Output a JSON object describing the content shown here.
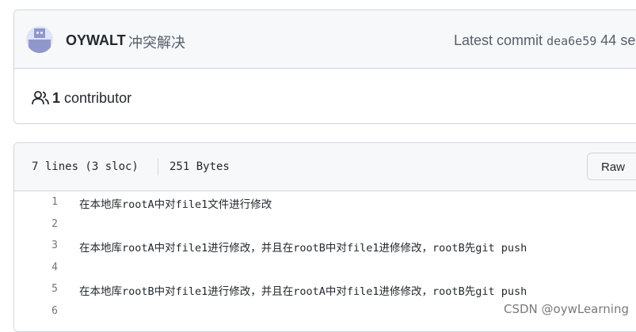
{
  "commit": {
    "author": "OYWALT",
    "message": "冲突解决",
    "latest_label": "Latest commit",
    "sha": "dea6e59",
    "time": "44 se"
  },
  "contributors": {
    "count": "1",
    "label": "contributor"
  },
  "file": {
    "lines_info": "7 lines (3 sloc)",
    "size": "251 Bytes",
    "raw_label": "Raw",
    "lines": [
      {
        "num": "1",
        "text": "在本地库rootA中对file1文件进行修改"
      },
      {
        "num": "2",
        "text": ""
      },
      {
        "num": "3",
        "text": "在本地库rootA中对file1进行修改，并且在rootB中对file1进修修改，rootB先git push"
      },
      {
        "num": "4",
        "text": ""
      },
      {
        "num": "5",
        "text": "在本地库rootB中对file1进行修改，并且在rootA中对file1进修修改，rootB先git push"
      },
      {
        "num": "6",
        "text": ""
      }
    ]
  },
  "watermark": "CSDN @oywLearning"
}
